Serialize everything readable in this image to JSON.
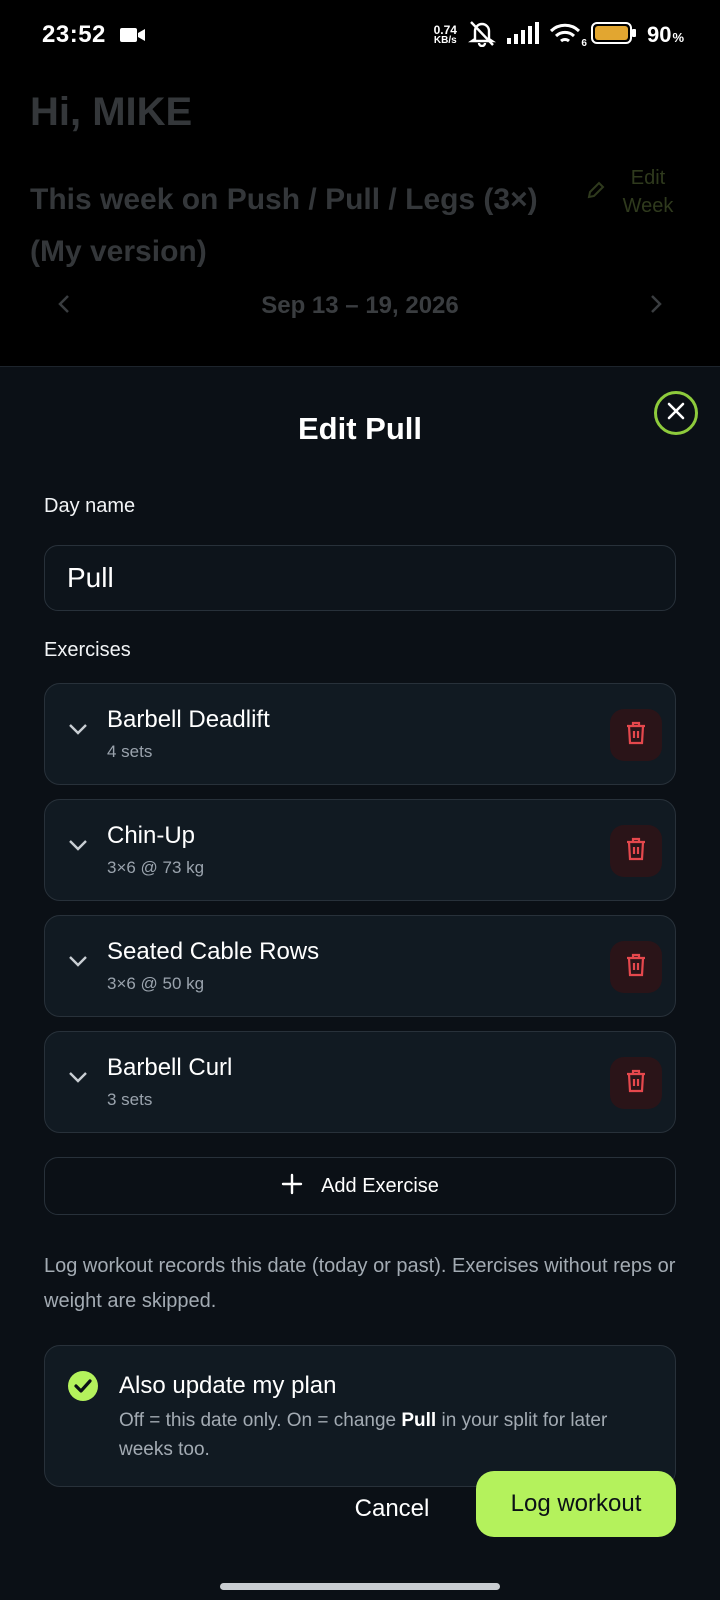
{
  "status_bar": {
    "time": "23:52",
    "net_speed_value": "0.74",
    "net_speed_unit": "KB/s",
    "battery_percent": "90",
    "battery_unit": "%",
    "wifi_badge": "6",
    "icons": [
      "video-camera-icon",
      "muted-bell-icon",
      "signal-icon",
      "wifi-icon",
      "battery-icon"
    ]
  },
  "background": {
    "greeting": "Hi, MIKE",
    "week_title": "This week on Push / Pull / Legs (3×) (My version)",
    "edit_week_label": "Edit Week",
    "week_range": "Sep 13 – 19, 2026"
  },
  "sheet": {
    "title": "Edit Pull",
    "day_name_label": "Day name",
    "day_name_value": "Pull",
    "exercises_label": "Exercises",
    "exercises": [
      {
        "name": "Barbell Deadlift",
        "detail": "4 sets"
      },
      {
        "name": "Chin-Up",
        "detail": "3×6 @ 73 kg"
      },
      {
        "name": "Seated Cable Rows",
        "detail": "3×6 @ 50 kg"
      },
      {
        "name": "Barbell Curl",
        "detail": "3 sets"
      }
    ],
    "add_exercise_label": "Add Exercise",
    "help_text": "Log workout records this date (today or past). Exercises without reps or weight are skipped.",
    "plan": {
      "title": "Also update my plan",
      "checked": true,
      "desc_prefix": "Off = this date only. On = change ",
      "desc_bold": "Pull",
      "desc_suffix": " in your split for later weeks too."
    },
    "cancel_label": "Cancel",
    "log_label": "Log workout"
  },
  "colors": {
    "accent": "#b4f25c",
    "close_ring": "#8ecb3c",
    "danger": "#e5484d",
    "sheet_bg": "#0b1016",
    "card_bg": "#111a22"
  }
}
